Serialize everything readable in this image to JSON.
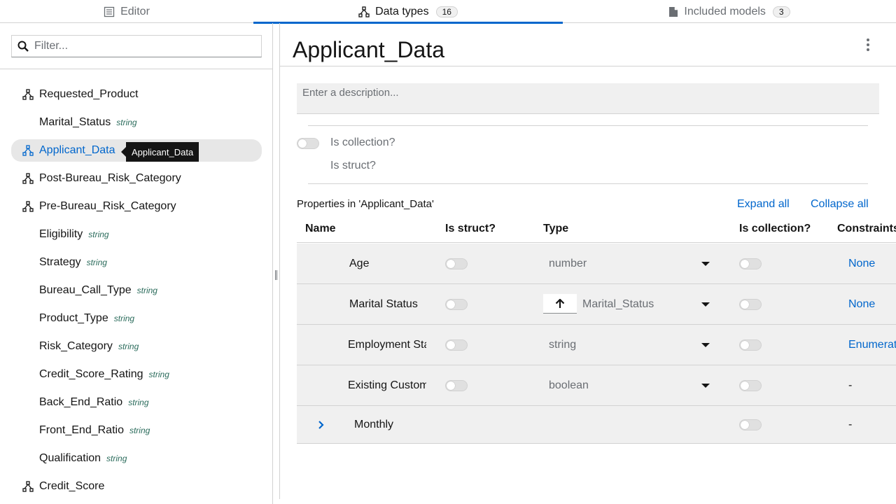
{
  "tabs": [
    {
      "label": "Editor",
      "icon": "editor-icon"
    },
    {
      "label": "Data types",
      "icon": "struct-icon",
      "count": "16"
    },
    {
      "label": "Included models",
      "icon": "file-icon",
      "count": "3"
    }
  ],
  "filter": {
    "placeholder": "Filter..."
  },
  "tree": [
    {
      "label": "Requested_Product",
      "kind": "struct"
    },
    {
      "label": "Marital_Status",
      "kind": "child",
      "type": "string"
    },
    {
      "label": "Applicant_Data",
      "kind": "struct",
      "selected": true
    },
    {
      "label": "Post-Bureau_Risk_Category",
      "kind": "struct"
    },
    {
      "label": "Pre-Bureau_Risk_Category",
      "kind": "struct"
    },
    {
      "label": "Eligibility",
      "kind": "child",
      "type": "string"
    },
    {
      "label": "Strategy",
      "kind": "child",
      "type": "string"
    },
    {
      "label": "Bureau_Call_Type",
      "kind": "child",
      "type": "string"
    },
    {
      "label": "Product_Type",
      "kind": "child",
      "type": "string"
    },
    {
      "label": "Risk_Category",
      "kind": "child",
      "type": "string"
    },
    {
      "label": "Credit_Score_Rating",
      "kind": "child",
      "type": "string"
    },
    {
      "label": "Back_End_Ratio",
      "kind": "child",
      "type": "string"
    },
    {
      "label": "Front_End_Ratio",
      "kind": "child",
      "type": "string"
    },
    {
      "label": "Qualification",
      "kind": "child",
      "type": "string"
    },
    {
      "label": "Credit_Score",
      "kind": "struct"
    }
  ],
  "tooltip": "Applicant_Data",
  "detail": {
    "title": "Applicant_Data",
    "description_placeholder": "Enter a description...",
    "is_collection_label": "Is collection?",
    "is_struct_label": "Is struct?",
    "properties_title": "Properties in 'Applicant_Data'",
    "expand_all": "Expand all",
    "collapse_all": "Collapse all",
    "columns": [
      "Name",
      "Is struct?",
      "Type",
      "Is collection?",
      "Constraints"
    ],
    "rows": [
      {
        "name": "Age",
        "type": "number",
        "constraint": "None",
        "constraint_link": true
      },
      {
        "name": "Marital Status",
        "type": "Marital_Status",
        "constraint": "None",
        "constraint_link": true,
        "has_up_button": true
      },
      {
        "name": "Employment Status",
        "type": "string",
        "constraint": "Enumeration",
        "constraint_link": true
      },
      {
        "name": "Existing Customer",
        "type": "boolean",
        "constraint": "-",
        "constraint_link": false
      },
      {
        "name": "Monthly",
        "type": "",
        "constraint": "-",
        "constraint_link": false,
        "expandable": true
      }
    ]
  }
}
